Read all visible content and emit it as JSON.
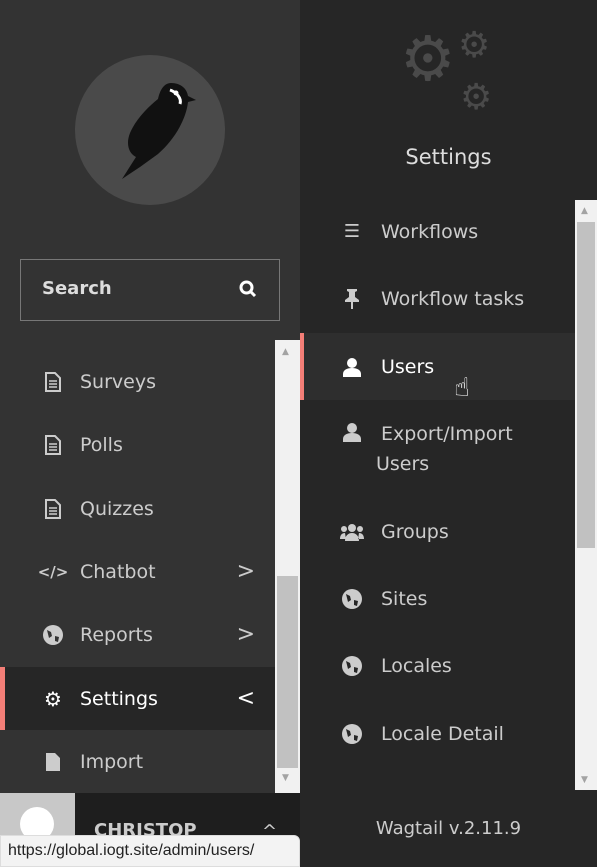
{
  "sidebar": {
    "search_label": "Search",
    "items": [
      {
        "label": "Surveys",
        "icon": "document-icon"
      },
      {
        "label": "Polls",
        "icon": "document-icon"
      },
      {
        "label": "Quizzes",
        "icon": "document-icon"
      },
      {
        "label": "Chatbot",
        "icon": "code-icon",
        "chevron": ">"
      },
      {
        "label": "Reports",
        "icon": "globe-icon",
        "chevron": ">"
      },
      {
        "label": "Settings",
        "icon": "cogs-icon",
        "chevron": "<",
        "active": true
      },
      {
        "label": "Import",
        "icon": "file-icon"
      }
    ],
    "user_name": "CHRISTOP",
    "user_chevron": "^"
  },
  "submenu": {
    "title": "Settings",
    "items": [
      {
        "label": "Workflows",
        "icon": "tasks-icon"
      },
      {
        "label": "Workflow tasks",
        "icon": "pin-icon"
      },
      {
        "label": "Users",
        "icon": "user-icon",
        "active": true
      },
      {
        "label": "Export/Import",
        "label2": "Users",
        "icon": "user-icon"
      },
      {
        "label": "Groups",
        "icon": "group-icon"
      },
      {
        "label": "Sites",
        "icon": "globe-icon"
      },
      {
        "label": "Locales",
        "icon": "globe-icon"
      },
      {
        "label": "Locale Detail",
        "icon": "globe-icon"
      }
    ],
    "version": "Wagtail v.2.11.9"
  },
  "status_url": "https://global.iogt.site/admin/users/",
  "colors": {
    "accent": "#f37e77",
    "sidebar_bg": "#333333",
    "submenu_bg": "#262626"
  }
}
